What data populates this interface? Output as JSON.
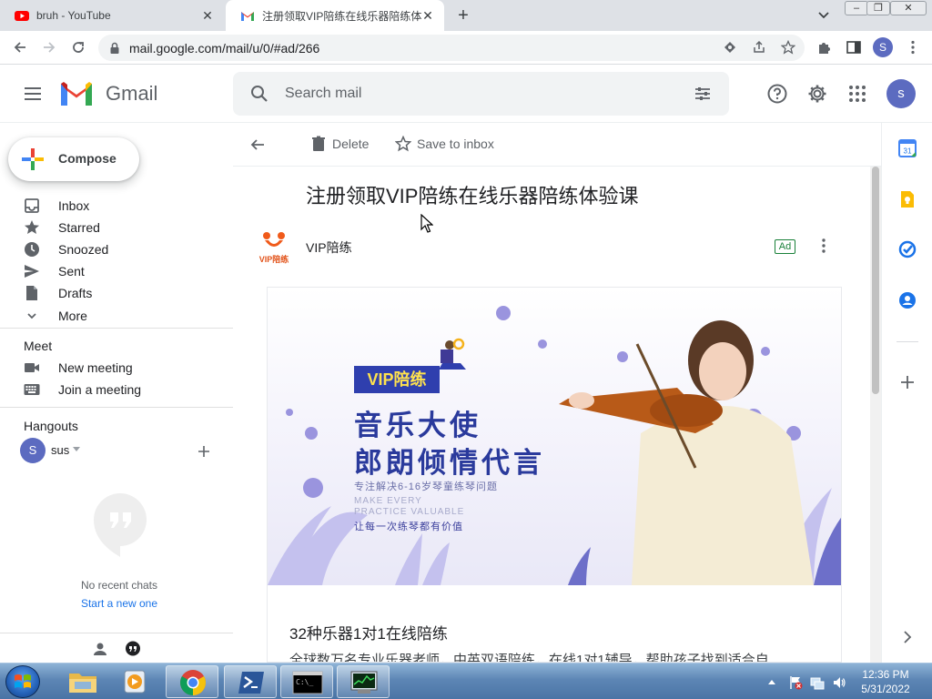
{
  "browser": {
    "tabs": [
      {
        "title": "bruh - YouTube",
        "icon": "youtube-icon",
        "active": false
      },
      {
        "title": "注册领取VIP陪练在线乐器陪练体",
        "icon": "gmail-icon",
        "active": true
      }
    ],
    "new_tab": "+",
    "url": "mail.google.com/mail/u/0/#ad/266",
    "profile_initial": "S"
  },
  "gmail": {
    "product_name": "Gmail",
    "search_placeholder": "Search mail",
    "account_initial": "s",
    "compose_label": "Compose",
    "nav": [
      {
        "label": "Inbox",
        "icon": "inbox-icon"
      },
      {
        "label": "Starred",
        "icon": "star-icon"
      },
      {
        "label": "Snoozed",
        "icon": "clock-icon"
      },
      {
        "label": "Sent",
        "icon": "send-icon"
      },
      {
        "label": "Drafts",
        "icon": "draft-icon"
      },
      {
        "label": "More",
        "icon": "chevron-down-icon"
      }
    ],
    "meet": {
      "heading": "Meet",
      "items": [
        {
          "label": "New meeting",
          "icon": "video-icon"
        },
        {
          "label": "Join a meeting",
          "icon": "keyboard-icon"
        }
      ]
    },
    "hangouts": {
      "heading": "Hangouts",
      "user_initial": "S",
      "user_name": "sus",
      "no_chats": "No recent chats",
      "start_new": "Start a new one"
    },
    "toolbar": {
      "delete_label": "Delete",
      "save_label": "Save to inbox"
    },
    "message": {
      "subject": "注册领取VIP陪练在线乐器陪练体验课",
      "sender": "VIP陪练",
      "sender_logo_text": "VIP陪练",
      "ad_badge": "Ad",
      "banner": {
        "tag": "VIP陪练",
        "line1": "音乐大使",
        "line2": "郎朗倾情代言",
        "sub1": "专注解决6-16岁琴童练琴问题",
        "sub2a": "MAKE EVERY",
        "sub2b": "PRACTICE VALUABLE",
        "sub3": "让每一次练琴都有价值"
      },
      "card_title": "32种乐器1对1在线陪练",
      "card_desc": "全球数万名专业乐器老师，中英双语陪练，在线1对1辅导，帮助孩子找到适合自"
    }
  },
  "taskbar": {
    "time": "12:36 PM",
    "date": "5/31/2022",
    "apps": [
      "file-explorer-icon",
      "media-player-icon",
      "chrome-icon",
      "powershell-icon",
      "cmd-icon",
      "task-manager-icon"
    ]
  },
  "colors": {
    "gmail_red": "#ea4335",
    "accent_blue": "#1a73e8",
    "banner_blue": "#2a3a9c"
  }
}
